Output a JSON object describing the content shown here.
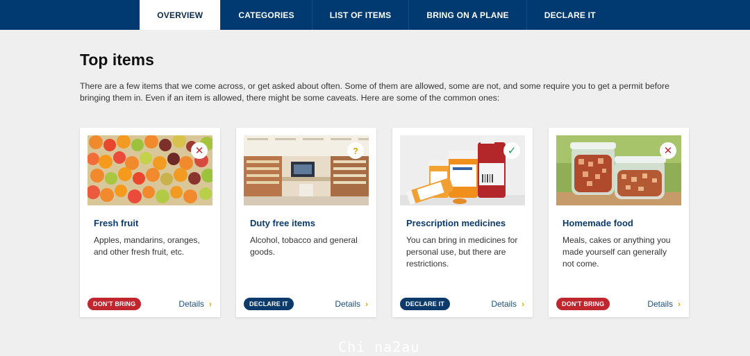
{
  "nav": {
    "tabs": [
      {
        "label": "OVERVIEW",
        "active": true
      },
      {
        "label": "CATEGORIES",
        "active": false
      },
      {
        "label": "LIST OF ITEMS",
        "active": false
      },
      {
        "label": "BRING ON A PLANE",
        "active": false
      },
      {
        "label": "DECLARE IT",
        "active": false
      }
    ]
  },
  "main": {
    "title": "Top items",
    "intro": "There are a few items that we come across, or get asked about often. Some of them are allowed, some are not, and some require you to get a permit before bringing them in. Even if an item is allowed, there might be some caveats. Here are some of the common ones:"
  },
  "cards": [
    {
      "title": "Fresh fruit",
      "desc": "Apples, mandarins, oranges, and other fresh fruit, etc.",
      "status": "DON'T BRING",
      "status_color": "#c0262d",
      "icon": "cross-icon",
      "details": "Details"
    },
    {
      "title": "Duty free items",
      "desc": "Alcohol, tobacco and general goods.",
      "status": "DECLARE IT",
      "status_color": "#0b3a6b",
      "icon": "question-icon",
      "details": "Details"
    },
    {
      "title": "Prescription medicines",
      "desc": "You can bring in medicines for personal use, but there are restrictions.",
      "status": "DECLARE IT",
      "status_color": "#0b3a6b",
      "icon": "check-icon",
      "details": "Details"
    },
    {
      "title": "Homemade food",
      "desc": "Meals, cakes or anything you made yourself can generally not come.",
      "status": "DON'T BRING",
      "status_color": "#c0262d",
      "icon": "cross-icon",
      "details": "Details"
    }
  ],
  "icons": {
    "cross": "✕",
    "question": "?",
    "check": "✓",
    "chevron": "›"
  },
  "watermark": "Chi na2au",
  "colors": {
    "nav_bg": "#003a70",
    "page_bg": "#efefef",
    "title_blue": "#0b3a6b",
    "red": "#c0262d",
    "accent_yellow": "#e6a800"
  }
}
